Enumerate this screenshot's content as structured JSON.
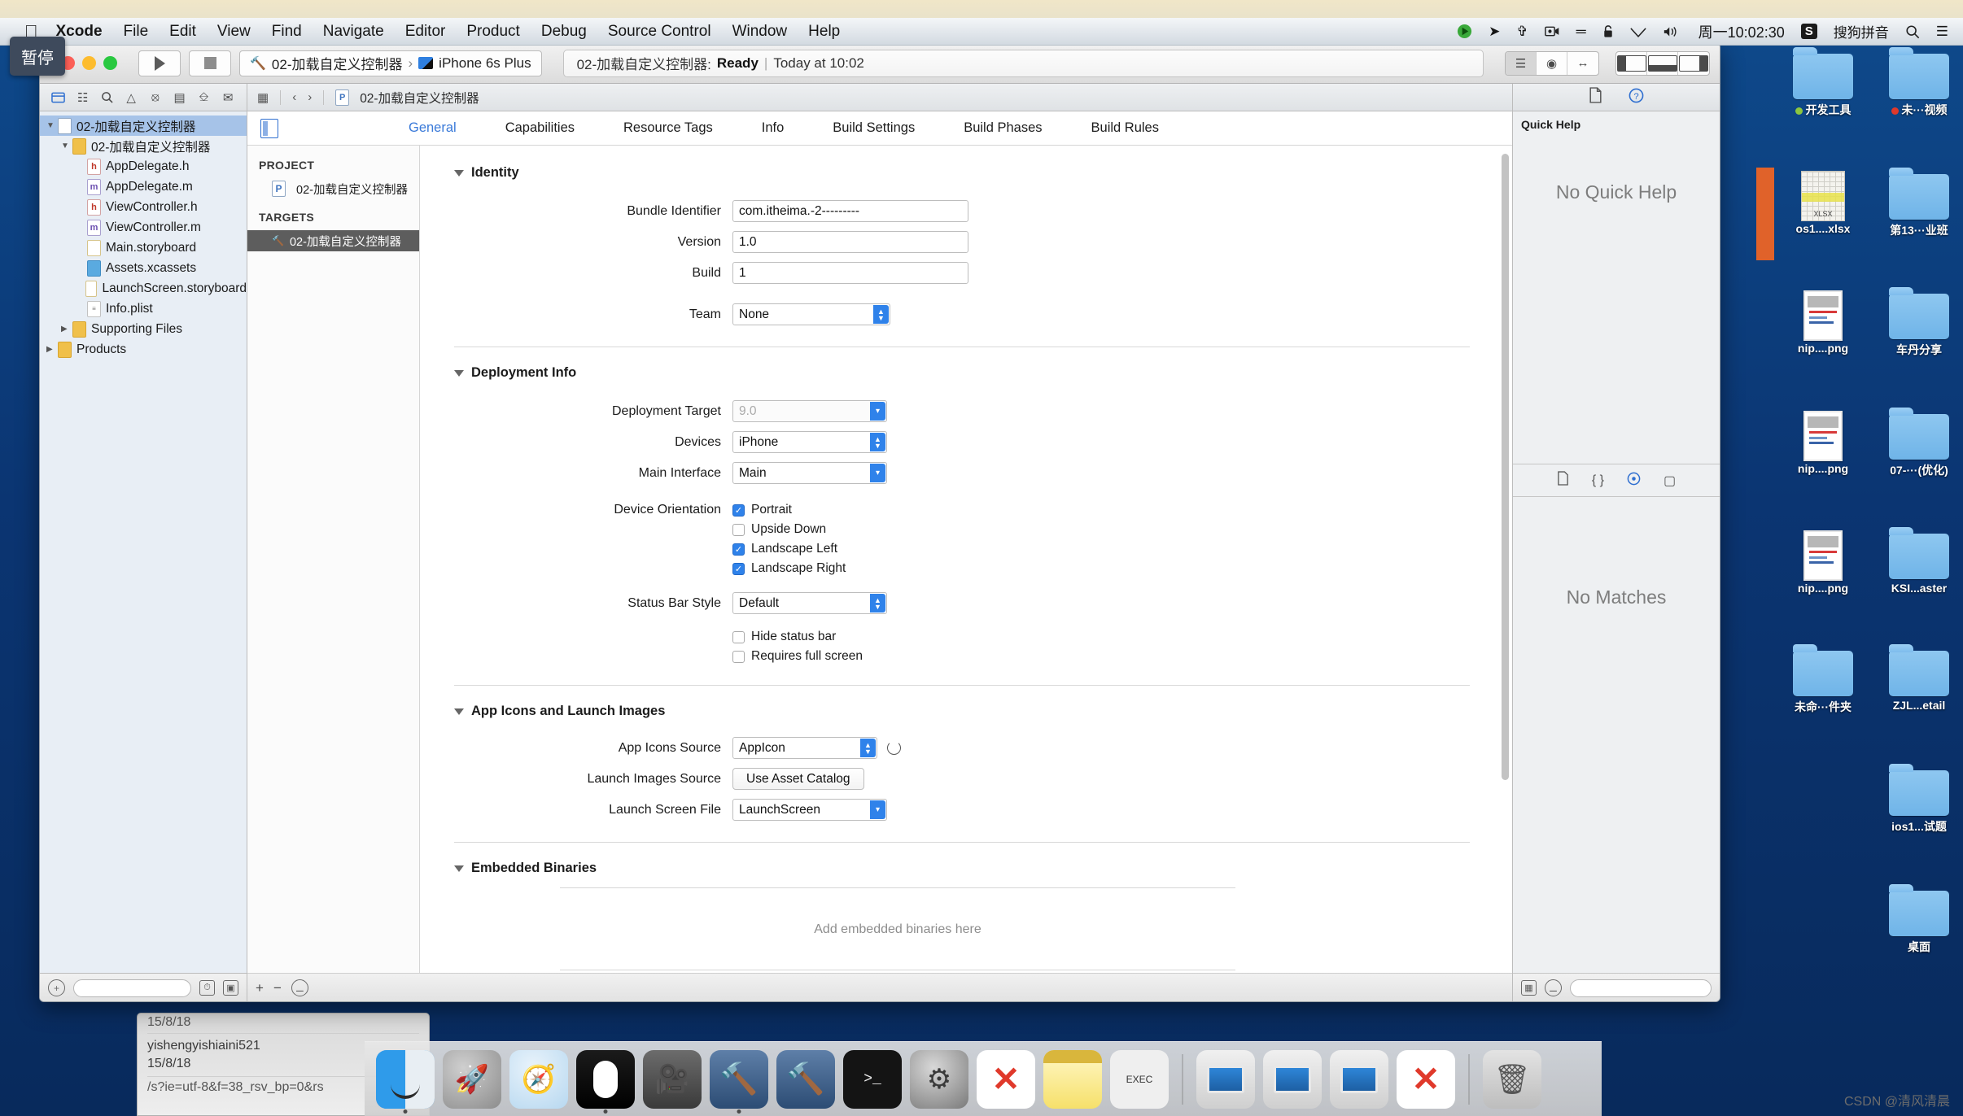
{
  "menubar": {
    "apple_icon": "apple-icon",
    "items": [
      {
        "label": "Xcode",
        "bold": true
      },
      {
        "label": "File"
      },
      {
        "label": "Edit"
      },
      {
        "label": "View"
      },
      {
        "label": "Find"
      },
      {
        "label": "Navigate"
      },
      {
        "label": "Editor"
      },
      {
        "label": "Product"
      },
      {
        "label": "Debug"
      },
      {
        "label": "Source Control"
      },
      {
        "label": "Window"
      },
      {
        "label": "Help"
      }
    ],
    "status_icons": [
      "record-icon",
      "location-icon",
      "bluetooth-icon",
      "screen-record-icon",
      "sound-meter-icon",
      "lock-icon",
      "wifi-icon",
      "volume-icon"
    ],
    "clock": "周一10:02:30",
    "input_method_badge": "S",
    "input_method": "搜狗拼音",
    "spotlight_icon": "search-icon",
    "notification_icon": "list-icon"
  },
  "pause_tooltip": "暂停",
  "xcode": {
    "toolbar": {
      "run_icon": "play-icon",
      "stop_icon": "stop-icon",
      "scheme_project": "02-加载自定义控制器",
      "scheme_separator": "›",
      "scheme_device": "iPhone 6s Plus",
      "status_project": "02-加载自定义控制器:",
      "status_state": "Ready",
      "status_divider": "|",
      "status_time": "Today at 10:02",
      "editor_segments": [
        "standard-editor-icon",
        "assistant-editor-icon",
        "version-editor-icon"
      ],
      "panel_buttons": [
        "toggle-navigator-icon",
        "toggle-debug-icon",
        "toggle-inspector-icon"
      ]
    },
    "navigator": {
      "tabs": [
        "project-navigator-icon",
        "symbol-navigator-icon",
        "find-navigator-icon",
        "issue-navigator-icon",
        "test-navigator-icon",
        "debug-navigator-icon",
        "breakpoint-navigator-icon",
        "report-navigator-icon"
      ],
      "tree": [
        {
          "label": "02-加载自定义控制器",
          "indent": 0,
          "icon": "proj",
          "twisty": "down",
          "selected": true
        },
        {
          "label": "02-加载自定义控制器",
          "indent": 1,
          "icon": "fold",
          "twisty": "down",
          "selected": false
        },
        {
          "label": "AppDelegate.h",
          "indent": 2,
          "icon": "h",
          "twisty": "",
          "selected": false
        },
        {
          "label": "AppDelegate.m",
          "indent": 2,
          "icon": "m",
          "twisty": "",
          "selected": false
        },
        {
          "label": "ViewController.h",
          "indent": 2,
          "icon": "h",
          "twisty": "",
          "selected": false
        },
        {
          "label": "ViewController.m",
          "indent": 2,
          "icon": "m",
          "twisty": "",
          "selected": false
        },
        {
          "label": "Main.storyboard",
          "indent": 2,
          "icon": "sb",
          "twisty": "",
          "selected": false
        },
        {
          "label": "Assets.xcassets",
          "indent": 2,
          "icon": "xc",
          "twisty": "",
          "selected": false
        },
        {
          "label": "LaunchScreen.storyboard",
          "indent": 2,
          "icon": "sb",
          "twisty": "",
          "selected": false
        },
        {
          "label": "Info.plist",
          "indent": 2,
          "icon": "plist",
          "twisty": "",
          "selected": false
        },
        {
          "label": "Supporting Files",
          "indent": 1,
          "icon": "fold",
          "twisty": "right",
          "selected": false
        },
        {
          "label": "Products",
          "indent": 0,
          "icon": "fold",
          "twisty": "right",
          "selected": false
        }
      ],
      "footer": {
        "add_icon": "add-icon",
        "filter_icon": "filter-icon",
        "search_placeholder": "",
        "clock_icon": "recent-icon",
        "source_icon": "source-control-icon"
      }
    },
    "jumpbar": {
      "related_icon": "related-files-icon",
      "back_icon": "chevron-left-icon",
      "forward_icon": "chevron-right-icon",
      "breadcrumb": "02-加载自定义控制器"
    },
    "tabs": [
      {
        "label": "General",
        "active": true
      },
      {
        "label": "Capabilities",
        "active": false
      },
      {
        "label": "Resource Tags",
        "active": false
      },
      {
        "label": "Info",
        "active": false
      },
      {
        "label": "Build Settings",
        "active": false
      },
      {
        "label": "Build Phases",
        "active": false
      },
      {
        "label": "Build Rules",
        "active": false
      }
    ],
    "target_list": {
      "project_header": "PROJECT",
      "project_item": "02-加载自定义控制器",
      "targets_header": "TARGETS",
      "target_item": "02-加载自定义控制器",
      "footer": {
        "add": "+",
        "remove": "−",
        "filter_icon": "filter-icon"
      }
    },
    "sections": {
      "identity": {
        "title": "Identity",
        "fields": [
          {
            "label": "Bundle Identifier",
            "value": "com.itheima.-2---------",
            "type": "text"
          },
          {
            "label": "Version",
            "value": "1.0",
            "type": "text"
          },
          {
            "label": "Build",
            "value": "1",
            "type": "text"
          },
          {
            "label": "Team",
            "value": "None",
            "type": "stepper"
          }
        ]
      },
      "deployment": {
        "title": "Deployment Info",
        "deployment_target_label": "Deployment Target",
        "deployment_target_value": "9.0",
        "devices_label": "Devices",
        "devices_value": "iPhone",
        "main_interface_label": "Main Interface",
        "main_interface_value": "Main",
        "device_orientation_label": "Device Orientation",
        "orientations": [
          {
            "label": "Portrait",
            "checked": true
          },
          {
            "label": "Upside Down",
            "checked": false
          },
          {
            "label": "Landscape Left",
            "checked": true
          },
          {
            "label": "Landscape Right",
            "checked": true
          }
        ],
        "status_bar_style_label": "Status Bar Style",
        "status_bar_style_value": "Default",
        "extra_checks": [
          {
            "label": "Hide status bar",
            "checked": false
          },
          {
            "label": "Requires full screen",
            "checked": false
          }
        ]
      },
      "app_icons": {
        "title": "App Icons and Launch Images",
        "app_icons_source_label": "App Icons Source",
        "app_icons_source_value": "AppIcon",
        "launch_images_source_label": "Launch Images Source",
        "launch_images_source_button": "Use Asset Catalog",
        "launch_screen_file_label": "Launch Screen File",
        "launch_screen_file_value": "LaunchScreen"
      },
      "embedded": {
        "title": "Embedded Binaries",
        "empty_message": "Add embedded binaries here"
      }
    },
    "inspector": {
      "tabs": [
        "file-inspector-icon",
        "quick-help-icon"
      ],
      "quick_help_title": "Quick Help",
      "quick_help_empty": "No Quick Help",
      "library_tabs": [
        "file-template-library-icon",
        "code-snippet-library-icon",
        "object-library-icon",
        "media-library-icon"
      ],
      "library_empty": "No Matches",
      "footer_search_placeholder": ""
    }
  },
  "desktop_icons": [
    {
      "label": "开发工具",
      "type": "folder",
      "dot": "#8cc63f"
    },
    {
      "label": "未···视频",
      "type": "folder",
      "dot": "#e0392b"
    },
    {
      "label": "os1....xlsx",
      "type": "xlsx",
      "dot": ""
    },
    {
      "label": "第13···业班",
      "type": "folder",
      "dot": ""
    },
    {
      "label": "nip....png",
      "type": "png",
      "dot": ""
    },
    {
      "label": "车丹分享",
      "type": "folder",
      "dot": ""
    },
    {
      "label": "nip....png",
      "type": "png",
      "dot": ""
    },
    {
      "label": "07-···(优化)",
      "type": "folder",
      "dot": ""
    },
    {
      "label": "nip....png",
      "type": "png",
      "dot": ""
    },
    {
      "label": "KSI...aster",
      "type": "folder",
      "dot": ""
    },
    {
      "label": "未命···件夹",
      "type": "folder",
      "dot": ""
    },
    {
      "label": "ZJL...etail",
      "type": "folder",
      "dot": ""
    },
    {
      "label": "",
      "type": "blank",
      "dot": ""
    },
    {
      "label": "ios1...试题",
      "type": "folder",
      "dot": ""
    },
    {
      "label": "",
      "type": "blank",
      "dot": ""
    },
    {
      "label": "桌面",
      "type": "folder",
      "dot": ""
    }
  ],
  "background_window": {
    "line1": "15/8/18",
    "line2": "yishengyishiaini521",
    "line3": "15/8/18",
    "line4": "/s?ie=utf-8&f=38_rsv_bp=0&rs"
  },
  "dock": [
    {
      "name": "finder",
      "label": "Finder",
      "running": true
    },
    {
      "name": "launchpad",
      "label": "Launchpad",
      "running": false
    },
    {
      "name": "safari",
      "label": "Safari",
      "running": false
    },
    {
      "name": "mouse",
      "label": "Mouse",
      "running": true
    },
    {
      "name": "imovie",
      "label": "iMovie",
      "running": false
    },
    {
      "name": "xcode",
      "label": "Xcode",
      "running": true
    },
    {
      "name": "xcode-beta",
      "label": "Xcode",
      "running": false
    },
    {
      "name": "terminal",
      "label": "Terminal",
      "running": false
    },
    {
      "name": "system-preferences",
      "label": "System Preferences",
      "running": false
    },
    {
      "name": "xmind",
      "label": "XMind",
      "running": false
    },
    {
      "name": "notes",
      "label": "Notes",
      "running": false
    },
    {
      "name": "exec",
      "label": "EXEC",
      "running": false
    },
    {
      "name": "screen1",
      "label": "Screen Sharing",
      "running": false
    },
    {
      "name": "screen2",
      "label": "Screen Sharing",
      "running": false
    },
    {
      "name": "screen3",
      "label": "Screen Sharing",
      "running": false
    },
    {
      "name": "close-x",
      "label": "Close",
      "running": false
    },
    {
      "name": "trash",
      "label": "Trash",
      "running": false
    }
  ],
  "watermark": "CSDN @清风清晨"
}
